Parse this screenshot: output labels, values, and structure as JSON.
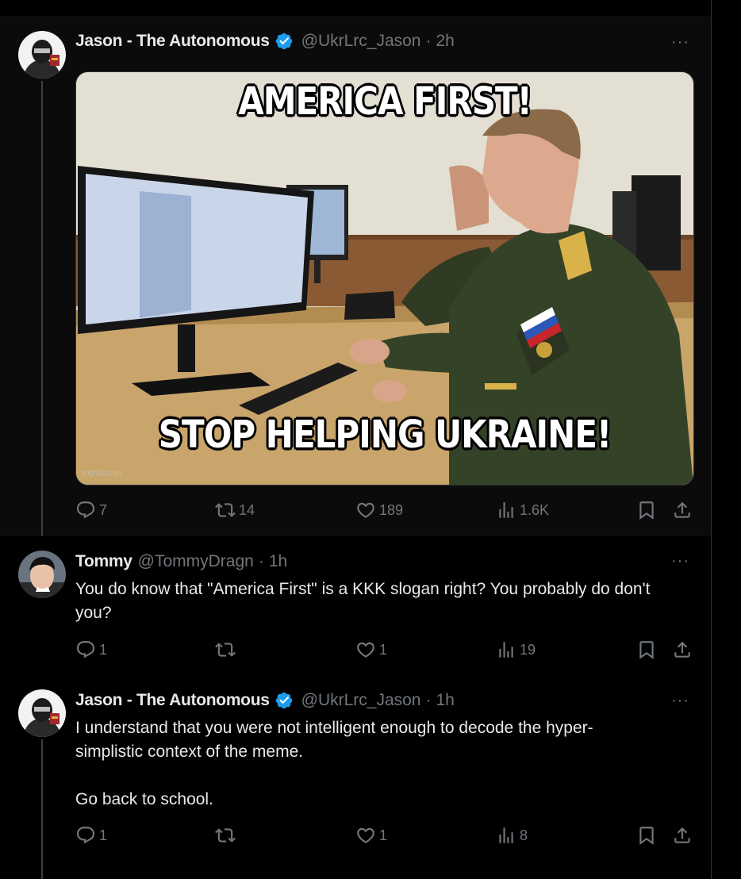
{
  "tweets": [
    {
      "author": {
        "name": "Jason - The Autonomous",
        "handle": "@UkrLrc_Jason",
        "time": "2h",
        "verified": true
      },
      "more_label": "···",
      "media": {
        "top_caption": "AMERICA FIRST!",
        "bottom_caption": "STOP HELPING UKRAINE!",
        "watermark": "imgflip.com"
      },
      "stats": {
        "replies": "7",
        "reposts": "14",
        "likes": "189",
        "views": "1.6K"
      }
    },
    {
      "author": {
        "name": "Tommy",
        "handle": "@TommyDragn",
        "time": "1h",
        "verified": false
      },
      "more_label": "···",
      "text": "You do know that \"America First\" is a KKK slogan right? You probably do don't you?",
      "stats": {
        "replies": "1",
        "reposts": "",
        "likes": "1",
        "views": "19"
      }
    },
    {
      "author": {
        "name": "Jason - The Autonomous",
        "handle": "@UkrLrc_Jason",
        "time": "1h",
        "verified": true
      },
      "more_label": "···",
      "text_lines": [
        "I understand that you were not intelligent enough to decode the hyper-",
        "simplistic context of the meme.",
        "",
        "Go back to school."
      ],
      "stats": {
        "replies": "1",
        "reposts": "",
        "likes": "1",
        "views": "8"
      }
    }
  ],
  "icons": {
    "reply": "reply-icon",
    "repost": "repost-icon",
    "like": "heart-icon",
    "views": "views-icon",
    "bookmark": "bookmark-icon",
    "share": "share-icon",
    "verified": "verified-badge-icon"
  },
  "colors": {
    "background": "#000000",
    "text": "#e7e9ea",
    "muted": "#71767b",
    "verified": "#1d9bf0"
  }
}
